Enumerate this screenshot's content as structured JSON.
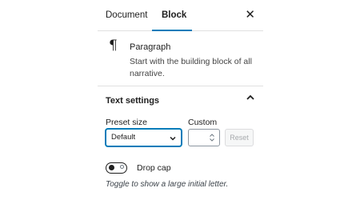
{
  "tabs": {
    "document_label": "Document",
    "block_label": "Block",
    "close_icon": "close-icon"
  },
  "block": {
    "icon": "paragraph-icon",
    "title": "Paragraph",
    "description": "Start with the building block of all narrative."
  },
  "text_settings": {
    "title": "Text settings",
    "expanded": true,
    "preset_label": "Preset size",
    "preset_value": "Default",
    "custom_label": "Custom",
    "custom_value": "",
    "reset_label": "Reset",
    "drop_cap_label": "Drop cap",
    "drop_cap_enabled": false,
    "drop_cap_help": "Toggle to show a large initial letter."
  },
  "colors": {
    "accent": "#007cba",
    "border": "#e0e0e0",
    "text": "#1e1e1e"
  }
}
